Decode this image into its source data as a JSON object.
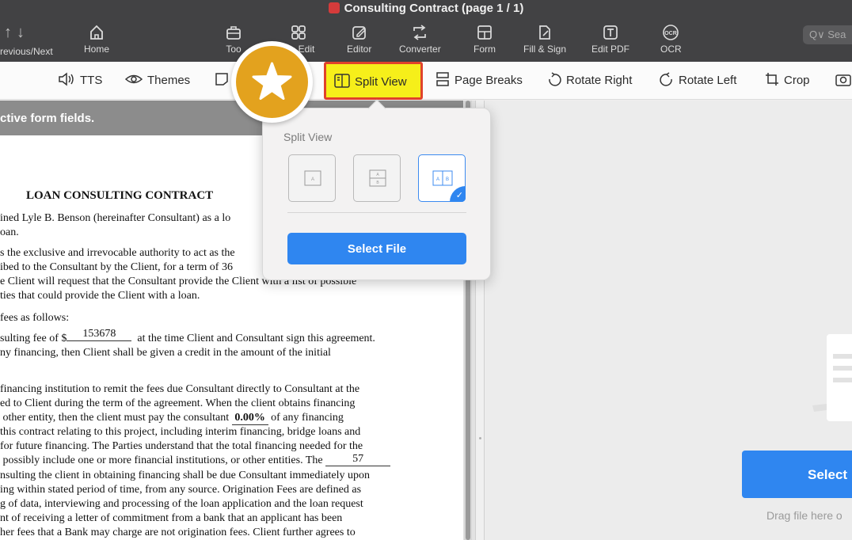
{
  "window": {
    "title": "Consulting Contract (page 1 / 1)"
  },
  "toolbar": {
    "prev_next_label": "revious/Next",
    "home_label": "Home",
    "tools_label": "Too",
    "edit_label": "Edit",
    "editor_label": "Editor",
    "converter_label": "Converter",
    "form_label": "Form",
    "fill_sign_label": "Fill & Sign",
    "edit_pdf_label": "Edit PDF",
    "ocr_label": "OCR",
    "search_placeholder": "Q∨ Sea"
  },
  "subtoolbar": {
    "tts_label": "TTS",
    "themes_label": "Themes",
    "split_view_label": "Split View",
    "page_breaks_label": "Page Breaks",
    "rotate_right_label": "Rotate Right",
    "rotate_left_label": "Rotate Left",
    "crop_label": "Crop"
  },
  "popover": {
    "title": "Split View",
    "options": [
      "single",
      "horizontal",
      "vertical"
    ],
    "selected": "vertical",
    "select_file_label": "Select File"
  },
  "document": {
    "notice": "ctive form fields.",
    "title": "LOAN CONSULTING CONTRACT",
    "lines": [
      "ined Lyle B. Benson (hereinafter Consultant) as a lo",
      "oan.",
      "s the exclusive and irrevocable authority to act as the",
      "ibed to the Consultant by the Client, for a term of 36",
      "e Client will request that the Consultant provide the Client with a list of possible",
      "ties that could provide the Client with a loan.",
      "fees as follows:",
      "sulting fee of $",
      "at the time Client and Consultant sign this agreement.",
      "ny financing, then Client shall be given a credit in the amount of the initial",
      "financing institution to remit the fees due Consultant directly to Consultant at the",
      "ed to Client during the term of the agreement. When the client obtains financing",
      "other entity, then the client must pay the consultant",
      "of any financing",
      "this contract relating to this project, including interim financing, bridge loans and",
      "for future financing.  The Parties understand that the total financing needed for the",
      "possibly include one or more financial institutions, or other entities. The",
      "nsulting the client in obtaining financing shall be due Consultant immediately upon",
      "ing within stated period of time, from any source.  Origination Fees are defined as",
      "g of data, interviewing and processing of the loan application and the loan request",
      "nt of receiving a letter of commitment from a bank that an applicant has been",
      "her fees that a Bank may charge are not origination fees.  Client further agrees to"
    ],
    "fee_amount": "153678",
    "percent": "0.00%",
    "count": "57"
  },
  "right_pane": {
    "select_label": "Select",
    "drag_hint": "Drag file here o"
  },
  "colors": {
    "accent": "#2f86f0",
    "highlight": "#f6ef1a",
    "highlight_border": "#e0422b",
    "badge": "#e3a21e"
  }
}
